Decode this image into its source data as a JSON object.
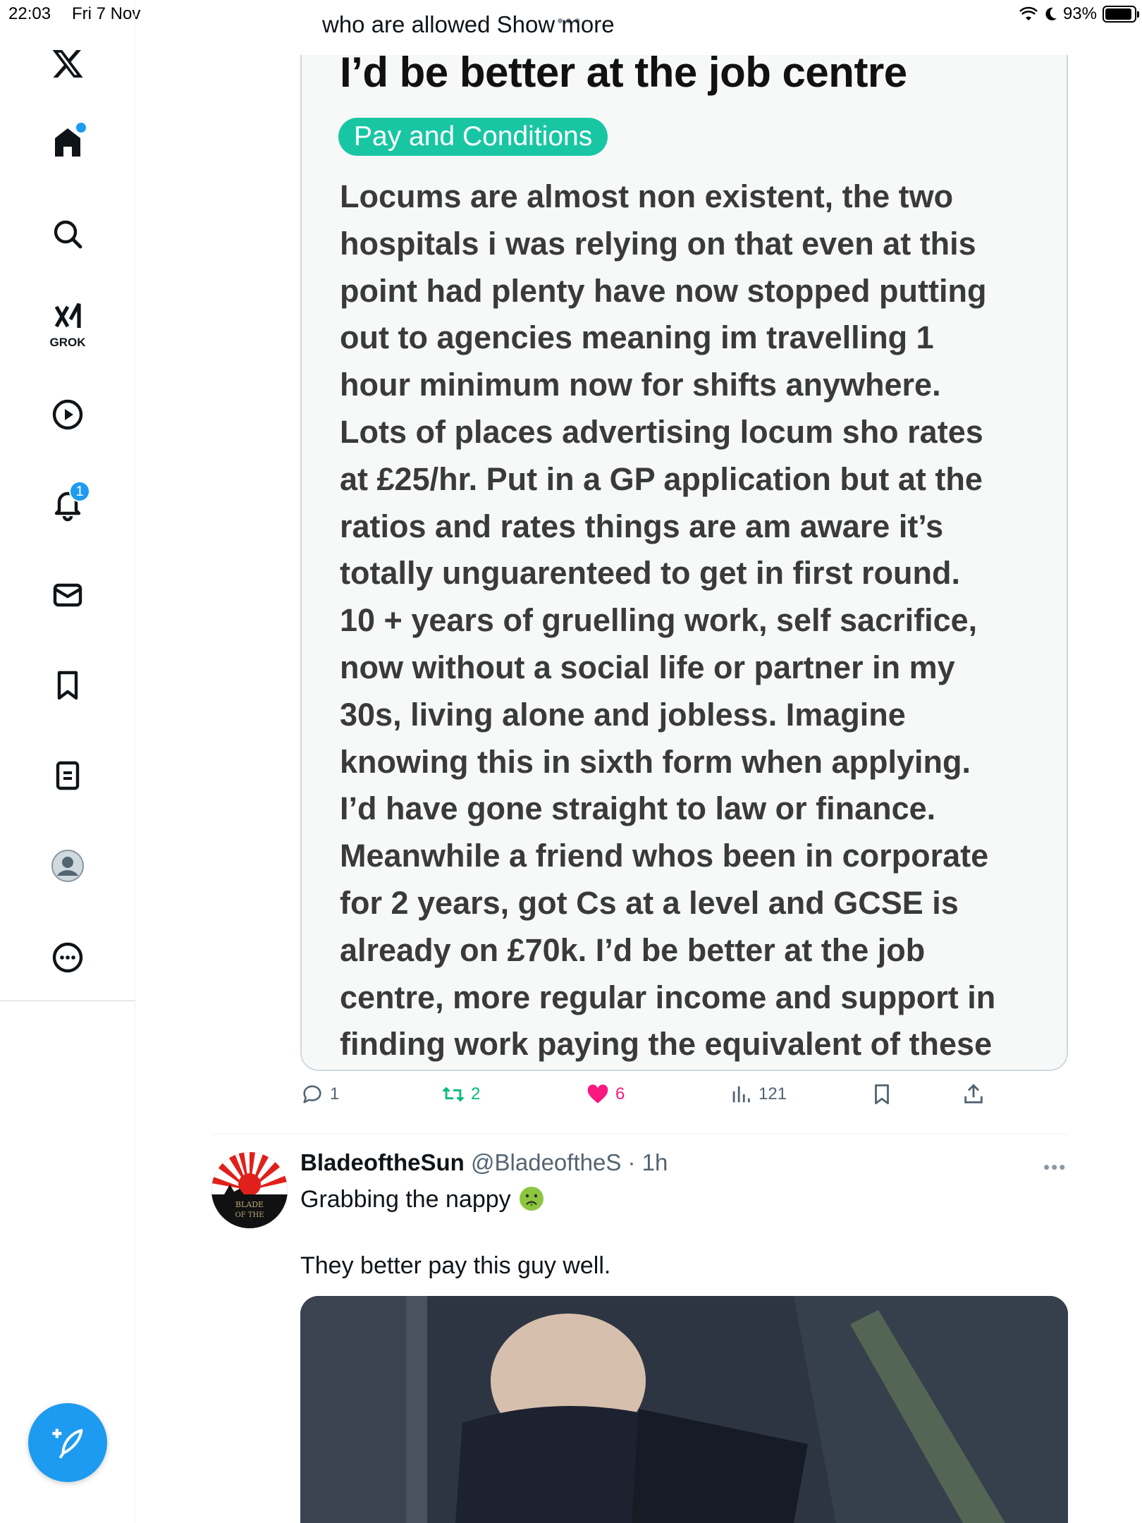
{
  "status_bar": {
    "time": "22:03",
    "date": "Fri 7 Nov",
    "battery": "93%",
    "battery_level": 0.93
  },
  "sidebar": {
    "items": [
      {
        "id": "logo",
        "icon": "x-logo-icon"
      },
      {
        "id": "home",
        "icon": "home-icon",
        "has_dot": true
      },
      {
        "id": "explore",
        "icon": "search-icon"
      },
      {
        "id": "grok",
        "icon": "grok-icon",
        "label": "GROK"
      },
      {
        "id": "video",
        "icon": "play-icon"
      },
      {
        "id": "notifications",
        "icon": "bell-icon",
        "badge": "1"
      },
      {
        "id": "messages",
        "icon": "mail-icon"
      },
      {
        "id": "bookmarks",
        "icon": "bookmark-icon"
      },
      {
        "id": "lists",
        "icon": "list-icon"
      },
      {
        "id": "profile",
        "icon": "avatar-icon"
      },
      {
        "id": "more",
        "icon": "more-icon"
      }
    ],
    "compose_icon": "compose-icon"
  },
  "tweet1": {
    "show_more_prefix": "who are allowed ",
    "show_more_link": "Show more",
    "quoted": {
      "title": "I’d be better at the job centre",
      "tag": "Pay and Conditions",
      "tag_color": "#19c6a4",
      "body_lines": [
        "Locums are almost non existent, the two",
        "hospitals i was relying on that even at this",
        "point had plenty have now stopped putting",
        "out to agencies meaning im travelling 1",
        "hour minimum now for shifts anywhere.",
        "Lots of places advertising locum sho rates",
        "at £25/hr. Put in a GP application but at the",
        "ratios and rates things are am aware it’s",
        "totally unguarenteed to get in first round.",
        "10 + years of gruelling work, self sacrifice,",
        "now without a social life or partner in my",
        "30s, living alone and jobless. Imagine",
        "knowing this in sixth form when applying.",
        "I’d have gone straight to law or finance.",
        "Meanwhile a friend whos been in corporate",
        "for 2 years, got Cs at a level and GCSE is",
        "already on £70k. I’d be better at the job",
        "centre, more regular income and support in",
        "finding work paying the equivalent of these"
      ]
    },
    "actions": {
      "replies": "1",
      "reposts": "2",
      "likes": "6",
      "views": "121"
    }
  },
  "tweet2": {
    "name": "BladeoftheSun",
    "handle": "@BladeoftheS",
    "time": "1h",
    "text_line1": "Grabbing the nappy",
    "text_line2": "They better pay this guy well.",
    "avatar_text": "BLADE OF THE SUN"
  },
  "colors": {
    "accent": "#1d9bf0",
    "like": "#f91880",
    "repost": "#00ba7c"
  }
}
